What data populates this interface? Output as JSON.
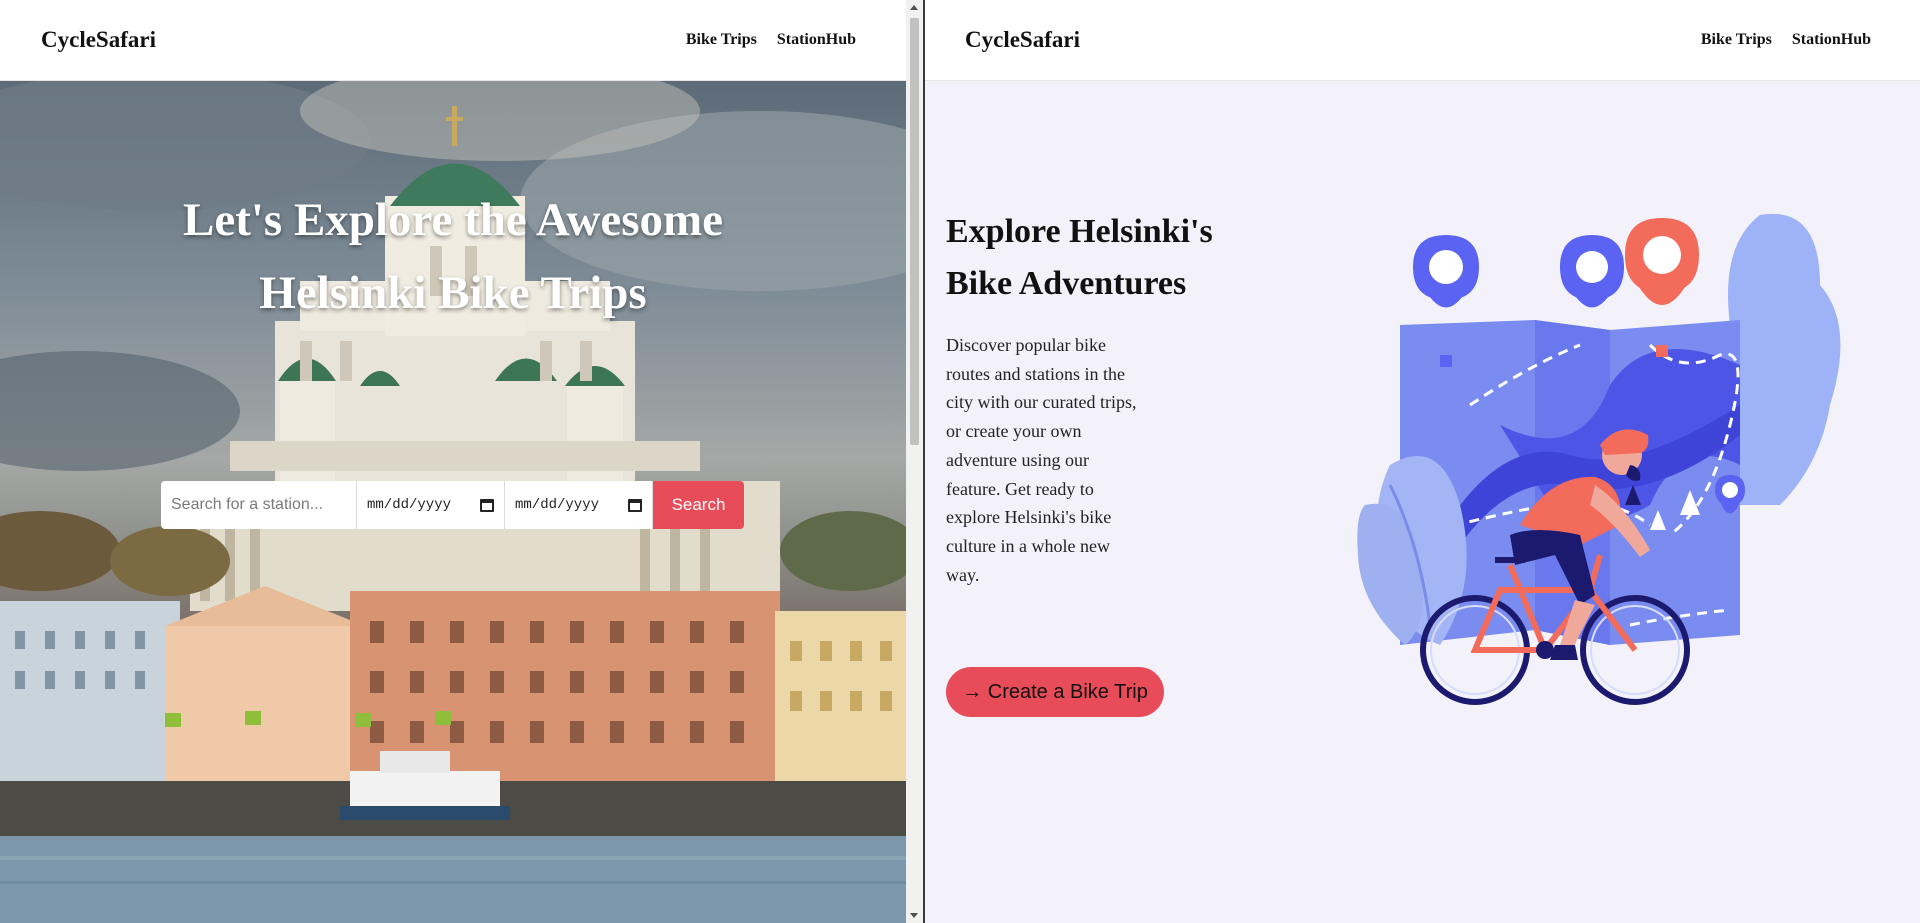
{
  "left_window": {
    "brand": "CycleSafari",
    "nav": [
      "Bike Trips",
      "StationHub"
    ],
    "hero_title": "Let's Explore the Awesome Helsinki Bike Trips",
    "search": {
      "placeholder": "Search for a station...",
      "start_date": "mm/dd/yyyy",
      "end_date": "mm/dd/yyyy",
      "button": "Search"
    }
  },
  "right_window": {
    "brand": "CycleSafari",
    "nav": [
      "Bike Trips",
      "StationHub"
    ],
    "heading": "Explore Helsinki's Bike Adventures",
    "body": "Discover popular bike routes and stations in the city with our curated trips, or create your own adventure using our feature. Get ready to explore Helsinki's bike culture in a whole new way.",
    "cta": "→ Create a Bike Trip"
  },
  "colors": {
    "accent": "#e84c59",
    "illustration_primary": "#5b63f2",
    "illustration_light": "#9eb0f7",
    "illustration_dark": "#1c1a6e"
  },
  "icons": [
    "calendar-icon",
    "location-pin-icon",
    "scroll-up-arrow-icon",
    "scroll-down-arrow-icon"
  ]
}
